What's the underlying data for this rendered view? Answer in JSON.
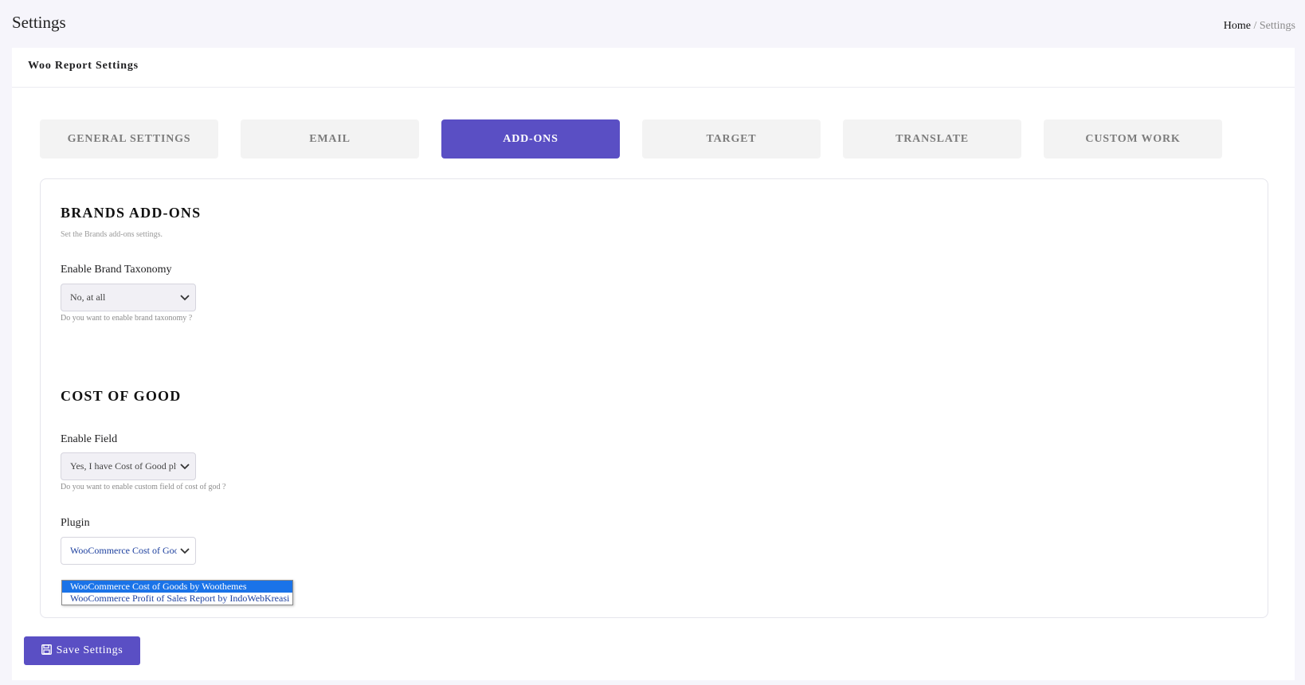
{
  "header": {
    "title": "Settings",
    "breadcrumb": {
      "home": "Home",
      "separator": "/",
      "current": "Settings"
    }
  },
  "card": {
    "title": "Woo Report Settings",
    "tabs": [
      {
        "label": "GENERAL SETTINGS",
        "active": false
      },
      {
        "label": "EMAIL",
        "active": false
      },
      {
        "label": "ADD-ONS",
        "active": true
      },
      {
        "label": "TARGET",
        "active": false
      },
      {
        "label": "TRANSLATE",
        "active": false
      },
      {
        "label": "CUSTOM WORK",
        "active": false
      }
    ]
  },
  "brands": {
    "title": "BRANDS ADD-ONS",
    "description": "Set the Brands add-ons settings.",
    "taxonomy_label": "Enable Brand Taxonomy",
    "taxonomy_value": "No, at all",
    "taxonomy_help": "Do you want to enable brand taxonomy ?"
  },
  "cost_of_good": {
    "title": "COST OF GOOD",
    "field_label": "Enable Field",
    "field_value": "Yes, I have Cost of Good plugin",
    "field_help": "Do you want to enable custom field of cost of god ?",
    "plugin_label": "Plugin",
    "plugin_value": "WooCommerce Cost of Goods by Woothemes",
    "plugin_options": [
      "WooCommerce Cost of Goods by Woothemes",
      "WooCommerce Profit of Sales Report by IndoWebKreasi"
    ]
  },
  "actions": {
    "save_label": "Save Settings"
  },
  "colors": {
    "accent": "#5a4fc4",
    "tab_inactive": "#f3f3f3",
    "option_highlight": "#1a73e8"
  },
  "icons": {
    "chevron": "chevron-down-icon",
    "save": "floppy-disk-icon"
  }
}
